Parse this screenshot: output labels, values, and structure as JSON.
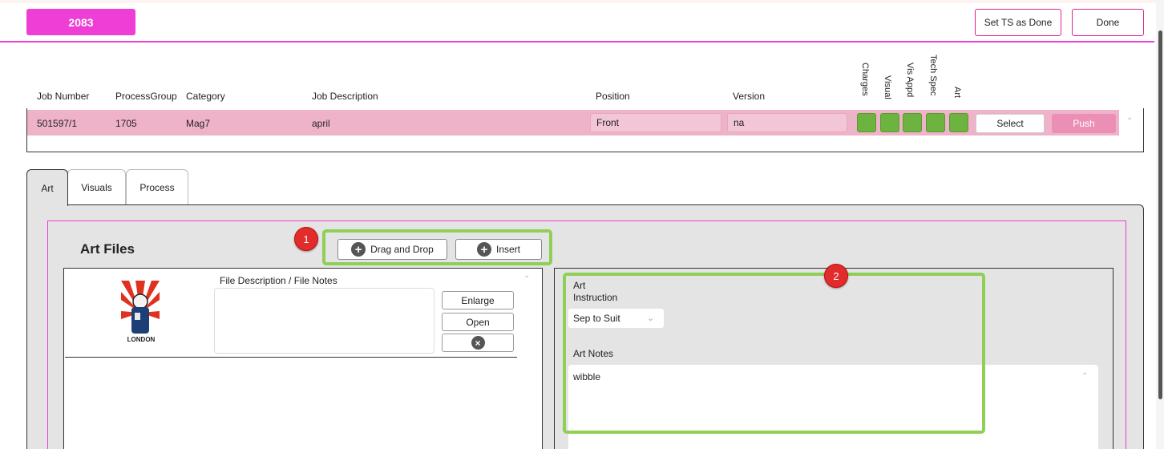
{
  "header": {
    "job_number_badge": "2083",
    "set_ts_done_label": "Set TS as Done",
    "done_label": "Done"
  },
  "columns": {
    "job_number": "Job Number",
    "process_group": "ProcessGroup",
    "category": "Category",
    "job_description": "Job Description",
    "position": "Position",
    "version": "Version",
    "charges": "Charges",
    "visual": "Visual",
    "vis_appd": "Vis Appd",
    "tech_spec": "Tech Spec",
    "art": "Art"
  },
  "job_row": {
    "job_number": "501597/1",
    "process_group": "1705",
    "category": "Mag7",
    "job_description": "april",
    "position": "Front",
    "version": "na",
    "status_color": "#6db33f",
    "select_label": "Select",
    "push_label": "Push"
  },
  "tabs": [
    {
      "label": "Art",
      "active": true
    },
    {
      "label": "Visuals",
      "active": false
    },
    {
      "label": "Process",
      "active": false
    }
  ],
  "art_files": {
    "title": "Art Files",
    "drag_drop_label": "Drag and Drop",
    "insert_label": "Insert",
    "file_desc_label": "File Description / File Notes",
    "file_desc_value": "",
    "enlarge_label": "Enlarge",
    "open_label": "Open",
    "thumbnail_caption": "LONDON"
  },
  "art_details": {
    "instruction_label_1": "Art",
    "instruction_label_2": "Instruction",
    "instruction_value": "Sep to Suit",
    "notes_label": "Art Notes",
    "notes_value": "wibble"
  },
  "callouts": {
    "badge_1": "1",
    "badge_2": "2",
    "highlight_color": "#8fcf55",
    "badge_color": "#e22b2b"
  },
  "colors": {
    "accent_pink": "#ee3ed6",
    "row_pink": "#efb3c9",
    "push_pink": "#ec8fb7"
  }
}
